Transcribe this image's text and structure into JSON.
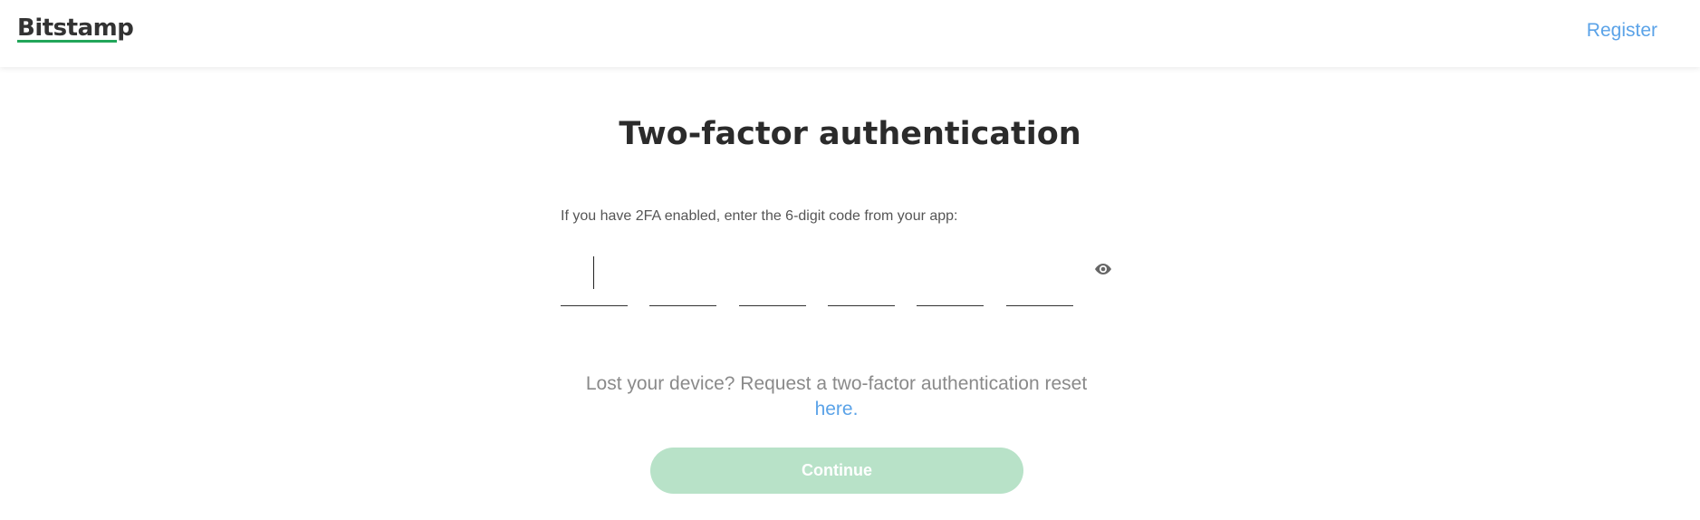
{
  "header": {
    "logo_text": "Bitstamp",
    "register_label": "Register"
  },
  "main": {
    "title": "Two-factor authentication",
    "instruction": "If you have 2FA enabled, enter the 6-digit code from your app:",
    "code_digits": [
      "",
      "",
      "",
      "",
      "",
      ""
    ],
    "lost_device_text": "Lost your device? Request a two-factor authentication reset",
    "here_link_label": "here.",
    "continue_label": "Continue"
  },
  "icons": {
    "visibility_toggle": "eye-icon"
  },
  "colors": {
    "brand_green": "#22a65a",
    "link_blue": "#5ba3e8",
    "button_disabled": "#b8e2c8"
  }
}
